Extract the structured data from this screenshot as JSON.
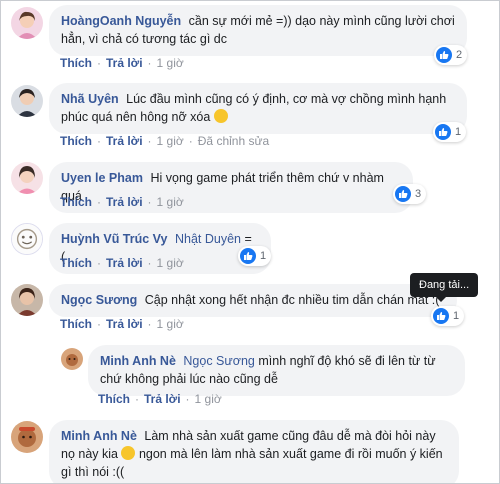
{
  "comments": [
    {
      "name": "HoàngOanh Nguyễn",
      "text": "cần sự mới mẻ =)) dạo này mình cũng lười chơi hẳn, vì chả có tương tác gì dc",
      "like_label": "Thích",
      "reply_label": "Trả lời",
      "time": "1 giờ",
      "reactions": "2"
    },
    {
      "name": "Nhã Uyên",
      "text": "Lúc đầu mình cũng có ý định, cơ mà vợ chồng mình hạnh phúc quá nên hông nỡ xóa",
      "like_label": "Thích",
      "reply_label": "Trả lời",
      "time": "1 giờ",
      "edited": "Đã chỉnh sửa",
      "reactions": "1"
    },
    {
      "name": "Uyen le Pham",
      "text": "Hi vọng game phát triển thêm chứ v nhàm quá",
      "like_label": "Thích",
      "reply_label": "Trả lời",
      "time": "1 giờ",
      "reactions": "3"
    },
    {
      "name": "Huỳnh Vũ Trúc Vy",
      "mention": "Nhật Duyên",
      "text": "= (",
      "like_label": "Thích",
      "reply_label": "Trả lời",
      "time": "1 giờ",
      "reactions": "1"
    },
    {
      "name": "Ngọc Sương",
      "text": "Cập nhật xong hết nhận đc nhiều tim dẫn chán mất :(",
      "like_label": "Thích",
      "reply_label": "Trả lời",
      "time": "1 giờ",
      "reactions": "1"
    },
    {
      "name": "Minh Anh Nè",
      "mention": "Ngọc Sương",
      "text": "mình nghĩ độ khó sẽ đi lên từ từ chứ không phải lúc nào cũng dễ",
      "like_label": "Thích",
      "reply_label": "Trả lời",
      "time": "1 giờ"
    },
    {
      "name": "Minh Anh Nè",
      "text_a": "Làm nhà sản xuất game cũng đâu dễ mà đòi hỏi này nọ này kia",
      "text_b": "ngon mà lên làm nhà sản xuất game đi rồi muốn ý kiến gì thì nói :(("
    }
  ],
  "tooltip": "Đang tải...",
  "colors": {
    "link": "#385898",
    "bubble": "#f2f3f5",
    "like_blue": "#1877f2"
  }
}
